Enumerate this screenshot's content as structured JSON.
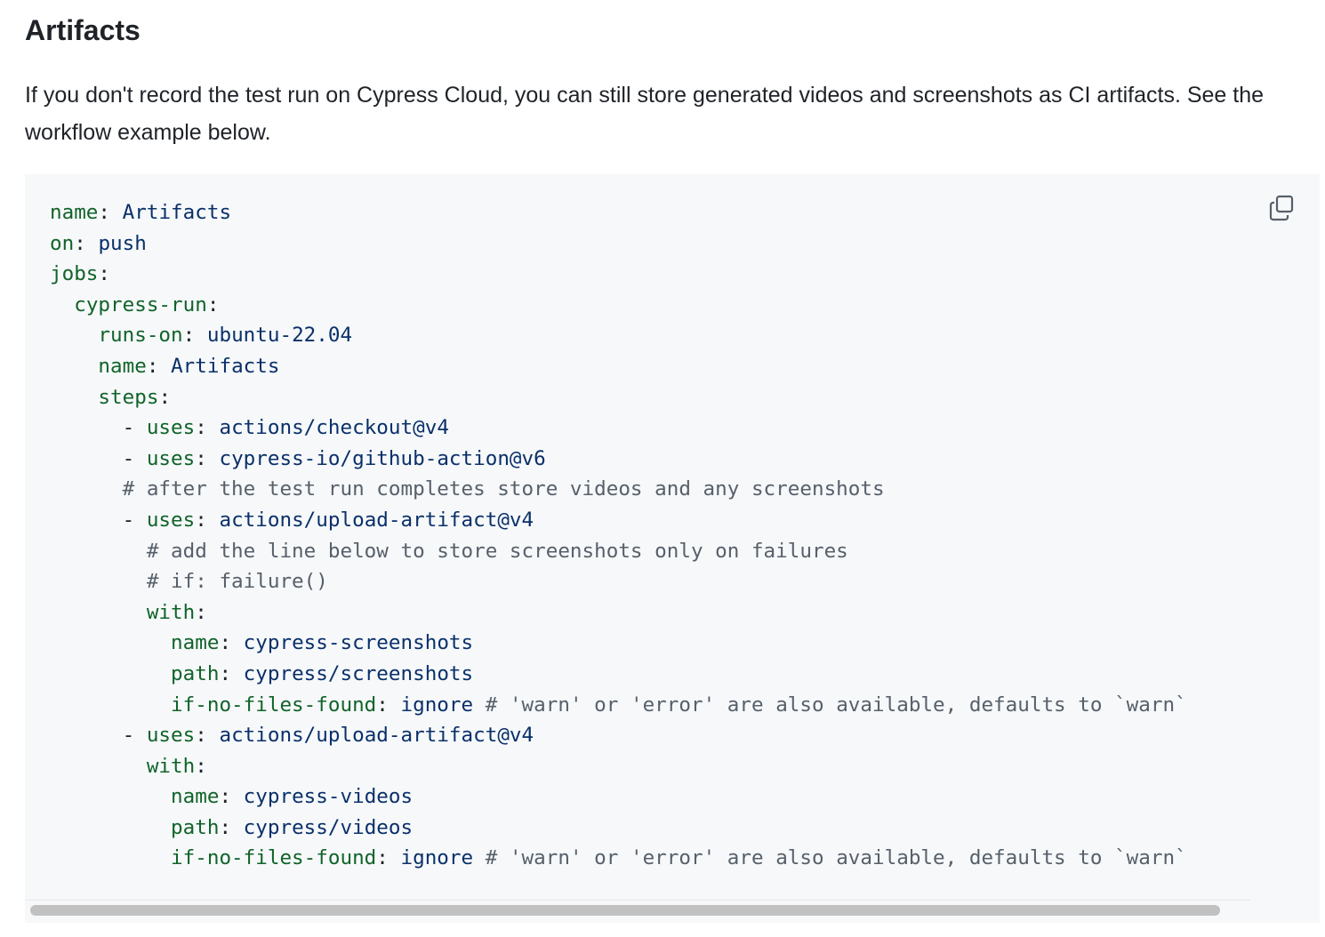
{
  "section": {
    "heading": "Artifacts",
    "lead": "If you don't record the test run on Cypress Cloud, you can still store generated videos and screenshots as CI artifacts. See the workflow example below."
  },
  "code": {
    "copy_icon": "copy-icon",
    "lines": [
      [
        {
          "t": "k",
          "s": "name"
        },
        {
          "t": "p",
          "s": ": "
        },
        {
          "t": "v",
          "s": "Artifacts"
        }
      ],
      [
        {
          "t": "k",
          "s": "on"
        },
        {
          "t": "p",
          "s": ": "
        },
        {
          "t": "v",
          "s": "push"
        }
      ],
      [
        {
          "t": "k",
          "s": "jobs"
        },
        {
          "t": "p",
          "s": ":"
        }
      ],
      [
        {
          "t": "p",
          "s": "  "
        },
        {
          "t": "k",
          "s": "cypress-run"
        },
        {
          "t": "p",
          "s": ":"
        }
      ],
      [
        {
          "t": "p",
          "s": "    "
        },
        {
          "t": "k",
          "s": "runs-on"
        },
        {
          "t": "p",
          "s": ": "
        },
        {
          "t": "v",
          "s": "ubuntu-22.04"
        }
      ],
      [
        {
          "t": "p",
          "s": "    "
        },
        {
          "t": "k",
          "s": "name"
        },
        {
          "t": "p",
          "s": ": "
        },
        {
          "t": "v",
          "s": "Artifacts"
        }
      ],
      [
        {
          "t": "p",
          "s": "    "
        },
        {
          "t": "k",
          "s": "steps"
        },
        {
          "t": "p",
          "s": ":"
        }
      ],
      [
        {
          "t": "p",
          "s": "      - "
        },
        {
          "t": "k",
          "s": "uses"
        },
        {
          "t": "p",
          "s": ": "
        },
        {
          "t": "v",
          "s": "actions/checkout@v4"
        }
      ],
      [
        {
          "t": "p",
          "s": "      - "
        },
        {
          "t": "k",
          "s": "uses"
        },
        {
          "t": "p",
          "s": ": "
        },
        {
          "t": "v",
          "s": "cypress-io/github-action@v6"
        }
      ],
      [
        {
          "t": "p",
          "s": "      "
        },
        {
          "t": "c",
          "s": "# after the test run completes store videos and any screenshots"
        }
      ],
      [
        {
          "t": "p",
          "s": "      - "
        },
        {
          "t": "k",
          "s": "uses"
        },
        {
          "t": "p",
          "s": ": "
        },
        {
          "t": "v",
          "s": "actions/upload-artifact@v4"
        }
      ],
      [
        {
          "t": "p",
          "s": "        "
        },
        {
          "t": "c",
          "s": "# add the line below to store screenshots only on failures"
        }
      ],
      [
        {
          "t": "p",
          "s": "        "
        },
        {
          "t": "c",
          "s": "# if: failure()"
        }
      ],
      [
        {
          "t": "p",
          "s": "        "
        },
        {
          "t": "k",
          "s": "with"
        },
        {
          "t": "p",
          "s": ":"
        }
      ],
      [
        {
          "t": "p",
          "s": "          "
        },
        {
          "t": "k",
          "s": "name"
        },
        {
          "t": "p",
          "s": ": "
        },
        {
          "t": "v",
          "s": "cypress-screenshots"
        }
      ],
      [
        {
          "t": "p",
          "s": "          "
        },
        {
          "t": "k",
          "s": "path"
        },
        {
          "t": "p",
          "s": ": "
        },
        {
          "t": "v",
          "s": "cypress/screenshots"
        }
      ],
      [
        {
          "t": "p",
          "s": "          "
        },
        {
          "t": "k",
          "s": "if-no-files-found"
        },
        {
          "t": "p",
          "s": ": "
        },
        {
          "t": "v",
          "s": "ignore"
        },
        {
          "t": "p",
          "s": " "
        },
        {
          "t": "c",
          "s": "# 'warn' or 'error' are also available, defaults to `warn`"
        }
      ],
      [
        {
          "t": "p",
          "s": "      - "
        },
        {
          "t": "k",
          "s": "uses"
        },
        {
          "t": "p",
          "s": ": "
        },
        {
          "t": "v",
          "s": "actions/upload-artifact@v4"
        }
      ],
      [
        {
          "t": "p",
          "s": "        "
        },
        {
          "t": "k",
          "s": "with"
        },
        {
          "t": "p",
          "s": ":"
        }
      ],
      [
        {
          "t": "p",
          "s": "          "
        },
        {
          "t": "k",
          "s": "name"
        },
        {
          "t": "p",
          "s": ": "
        },
        {
          "t": "v",
          "s": "cypress-videos"
        }
      ],
      [
        {
          "t": "p",
          "s": "          "
        },
        {
          "t": "k",
          "s": "path"
        },
        {
          "t": "p",
          "s": ": "
        },
        {
          "t": "v",
          "s": "cypress/videos"
        }
      ],
      [
        {
          "t": "p",
          "s": "          "
        },
        {
          "t": "k",
          "s": "if-no-files-found"
        },
        {
          "t": "p",
          "s": ": "
        },
        {
          "t": "v",
          "s": "ignore"
        },
        {
          "t": "p",
          "s": " "
        },
        {
          "t": "c",
          "s": "# 'warn' or 'error' are also available, defaults to `warn`"
        }
      ]
    ]
  },
  "colors": {
    "key": "#116329",
    "value": "#0a3069",
    "comment": "#57606a",
    "code_bg": "#f6f8fa",
    "scroll_thumb": "#c1c1c1"
  }
}
